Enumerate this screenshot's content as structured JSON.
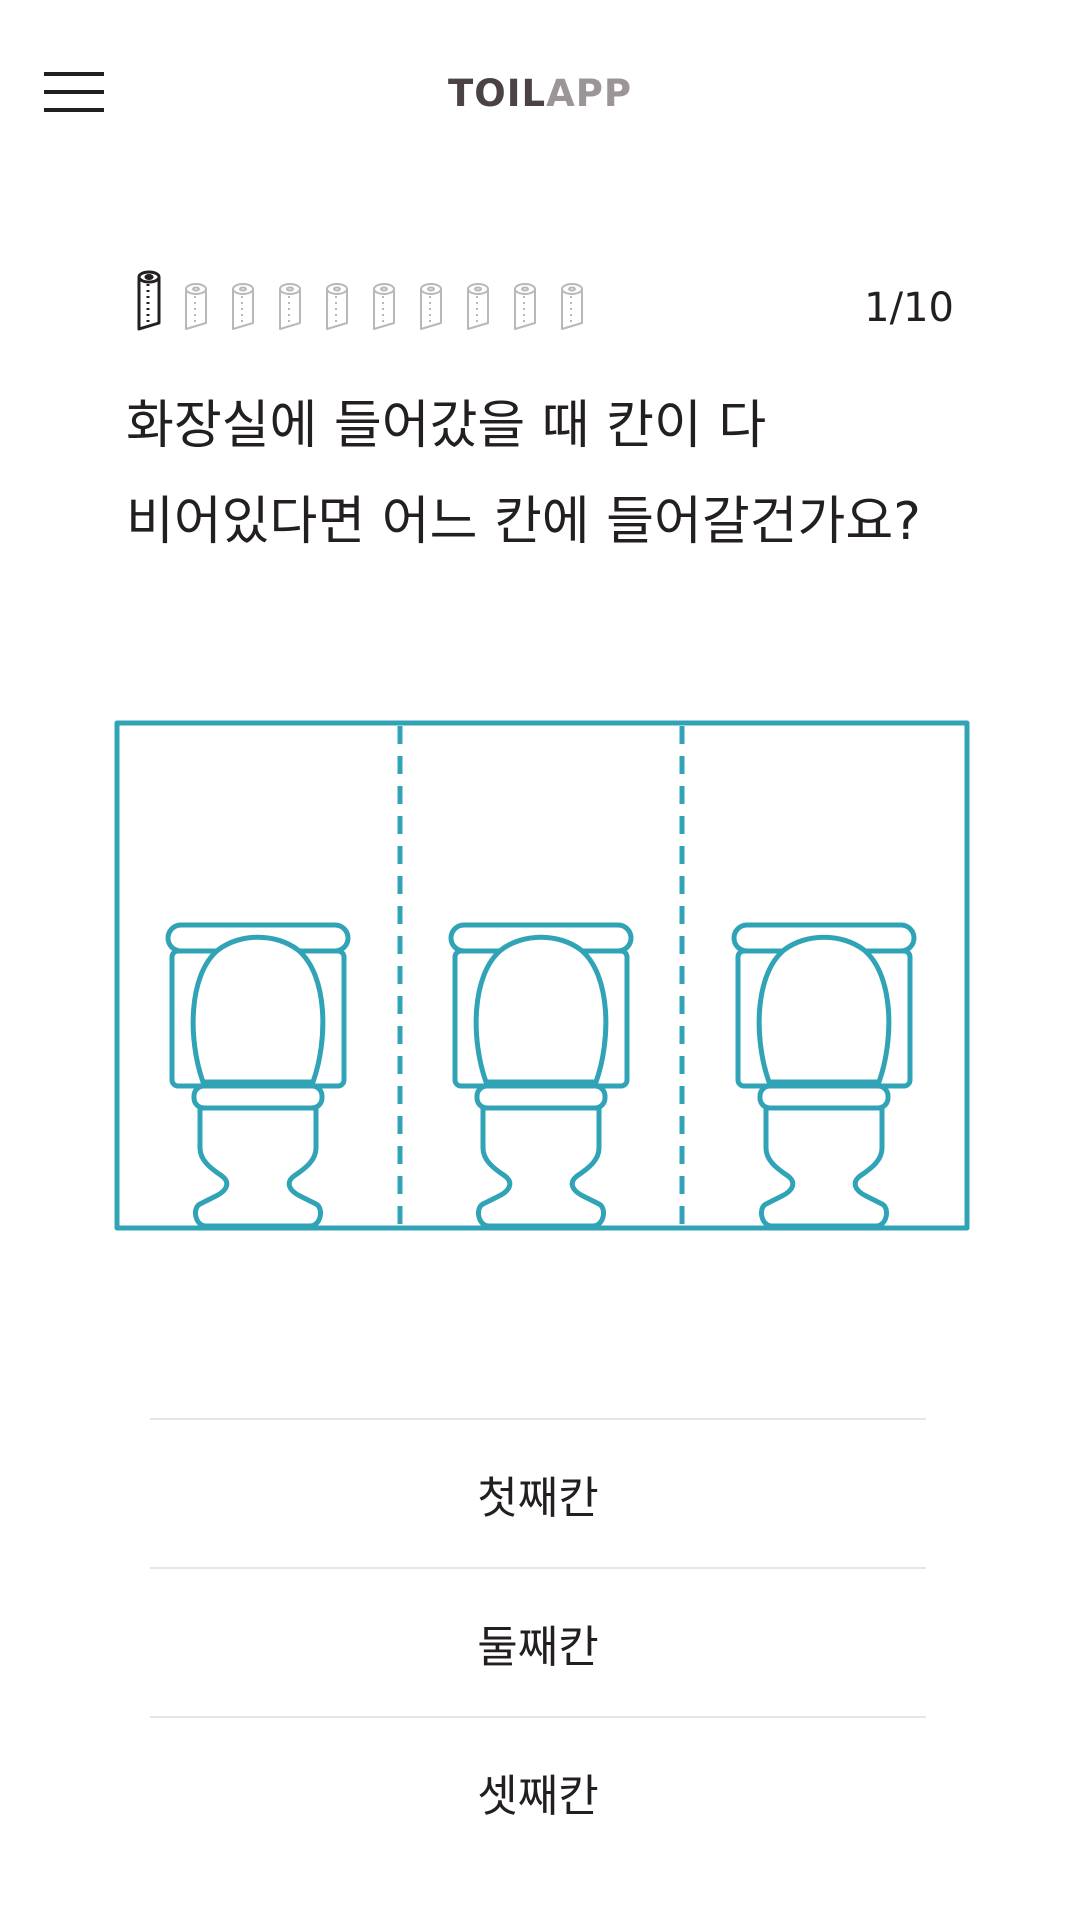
{
  "header": {
    "logo_part1": "TOIL",
    "logo_part2": "APP"
  },
  "progress": {
    "counter_text": "1/10",
    "current": 1,
    "total": 10
  },
  "question": {
    "line1": "화장실에 들어갔을 때 칸이 다",
    "line2": "비어있다면 어느 칸에 들어갈건가요?"
  },
  "options": [
    {
      "label": "첫째칸"
    },
    {
      "label": "둘째칸"
    },
    {
      "label": "셋째칸"
    }
  ],
  "colors": {
    "accent": "#31a3b6",
    "text": "#231f20",
    "logo_dark": "#4a4244",
    "logo_light": "#9b9597",
    "inactive_roll": "#b8b8b8",
    "divider": "#e6e6e6"
  },
  "icons": [
    "menu-icon",
    "toilet-paper-roll-icon",
    "toilet-icon"
  ]
}
